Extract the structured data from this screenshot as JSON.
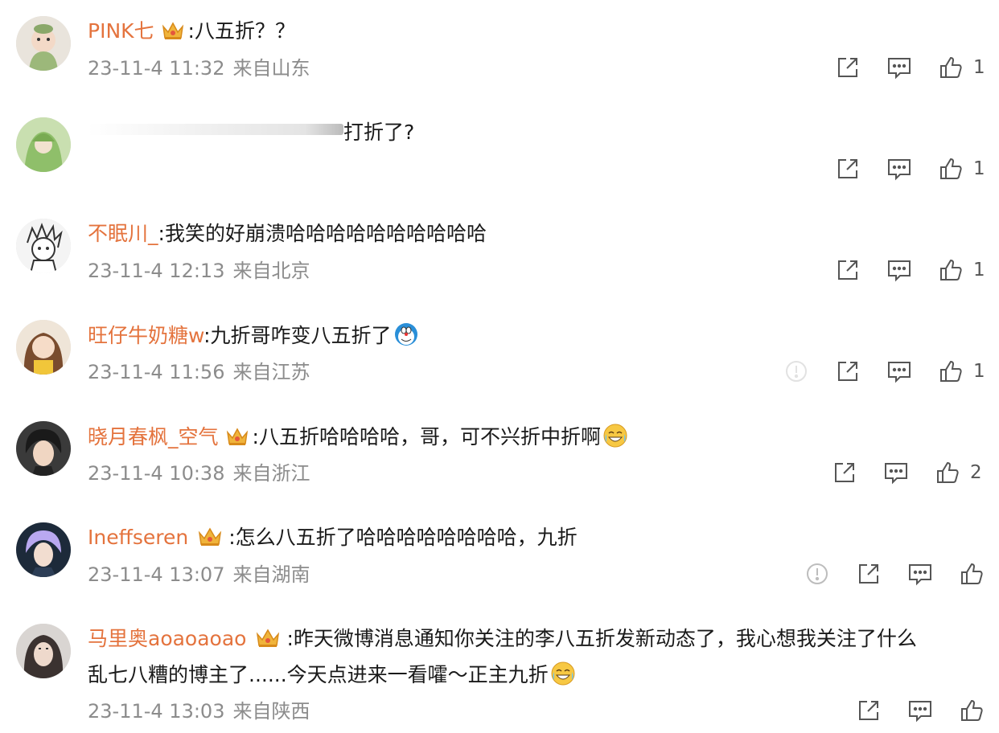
{
  "comments": [
    {
      "username": "PINK七",
      "text": "八五折？？",
      "timestamp": "23-11-4 11:32",
      "location": "来自山东",
      "likes": "1"
    },
    {
      "username": "",
      "text": "打折了?",
      "timestamp": "",
      "location": "",
      "likes": "1"
    },
    {
      "username": "不眠川_",
      "text": "我笑的好崩溃哈哈哈哈哈哈哈哈哈哈",
      "timestamp": "23-11-4 12:13",
      "location": "来自北京",
      "likes": "1"
    },
    {
      "username": "旺仔牛奶糖w",
      "text": "九折哥咋变八五折了",
      "timestamp": "23-11-4 11:56",
      "location": "来自江苏",
      "likes": "1"
    },
    {
      "username": "晓月春枫_空气",
      "text": "八五折哈哈哈哈，哥，可不兴折中折啊",
      "timestamp": "23-11-4 10:38",
      "location": "来自浙江",
      "likes": "2"
    },
    {
      "username": "Ineffseren",
      "text": "怎么八五折了哈哈哈哈哈哈哈哈，九折",
      "timestamp": "23-11-4 13:07",
      "location": "来自湖南",
      "likes": ""
    },
    {
      "username": "马里奥aoaoaoao",
      "text": "昨天微博消息通知你关注的李八五折发新动态了，我心想我关注了什么",
      "text_line2": "乱七八糟的博主了......今天点进来一看嚯～正主九折",
      "timestamp": "23-11-4 13:03",
      "location": "来自陕西",
      "likes": ""
    }
  ],
  "colon": ":",
  "icons": {
    "share": "share-icon",
    "comment": "comment-icon",
    "like": "thumbs-up-icon",
    "report": "report-icon",
    "crown": "vip-crown-icon"
  },
  "colors": {
    "username": "#e4733d",
    "meta": "#8c8c8c",
    "icon": "#555555"
  }
}
